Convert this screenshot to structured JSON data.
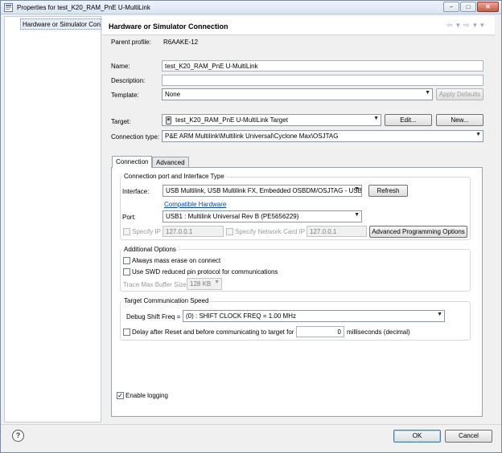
{
  "window": {
    "title": "Properties for test_K20_RAM_PnE U-MultiLink",
    "min": "−",
    "max": "□",
    "close": "✕"
  },
  "tree": {
    "selected": "Hardware or Simulator Connection"
  },
  "page": {
    "title": "Hardware or Simulator Connection",
    "nav": "⇦ ▾ ⇨ ▾ ▾"
  },
  "form": {
    "parent_profile_label": "Parent profile:",
    "parent_profile_value": "R6AAKE-12",
    "name_label": "Name:",
    "name_value": "test_K20_RAM_PnE U-MultiLink",
    "description_label": "Description:",
    "description_value": "",
    "template_label": "Template:",
    "template_value": "None",
    "apply_defaults": "Apply Defaults",
    "target_label": "Target:",
    "target_value": "test_K20_RAM_PnE U-MultiLink Target",
    "edit_button": "Edit...",
    "new_button": "New...",
    "connection_type_label": "Connection type:",
    "connection_type_value": "P&E ARM Multilink\\Multilink Universal\\Cyclone Max\\OSJTAG"
  },
  "tabs": [
    "Connection",
    "Advanced"
  ],
  "connection": {
    "group1_title": "Connection port and Interface Type",
    "interface_label": "Interface:",
    "interface_value": "USB Multilink, USB Multilink FX, Embedded OSBDM/OSJTAG - USB",
    "refresh_button": "Refresh",
    "compatible_hardware": "Compatible Hardware",
    "port_label": "Port:",
    "port_value": "USB1 : Multilink Universal Rev B (PE5656229)",
    "specify_ip_label": "Specify IP",
    "specify_ip_value": "127.0.0.1",
    "specify_nic_label": "Specify Network Card IP",
    "specify_nic_value": "127.0.0.1",
    "advanced_programming": "Advanced Programming Options",
    "group2_title": "Additional Options",
    "mass_erase_label": "Always mass erase on connect",
    "swd_label": "Use SWD reduced pin protocol for communications",
    "trace_label": "Trace Max Buffer Size:",
    "trace_value": "128 KB",
    "group3_title": "Target Communication Speed",
    "debug_shift_label": "Debug Shift Freq =",
    "debug_shift_value": "(0) : SHIFT CLOCK FREQ = 1.00 MHz",
    "delay_label": "Delay after Reset and before communicating to target for",
    "delay_value": "0",
    "delay_unit": "milliseconds (decimal)",
    "enable_logging_label": "Enable logging",
    "enable_logging_checked": "✓"
  },
  "footer": {
    "help": "?",
    "ok": "OK",
    "cancel": "Cancel"
  }
}
